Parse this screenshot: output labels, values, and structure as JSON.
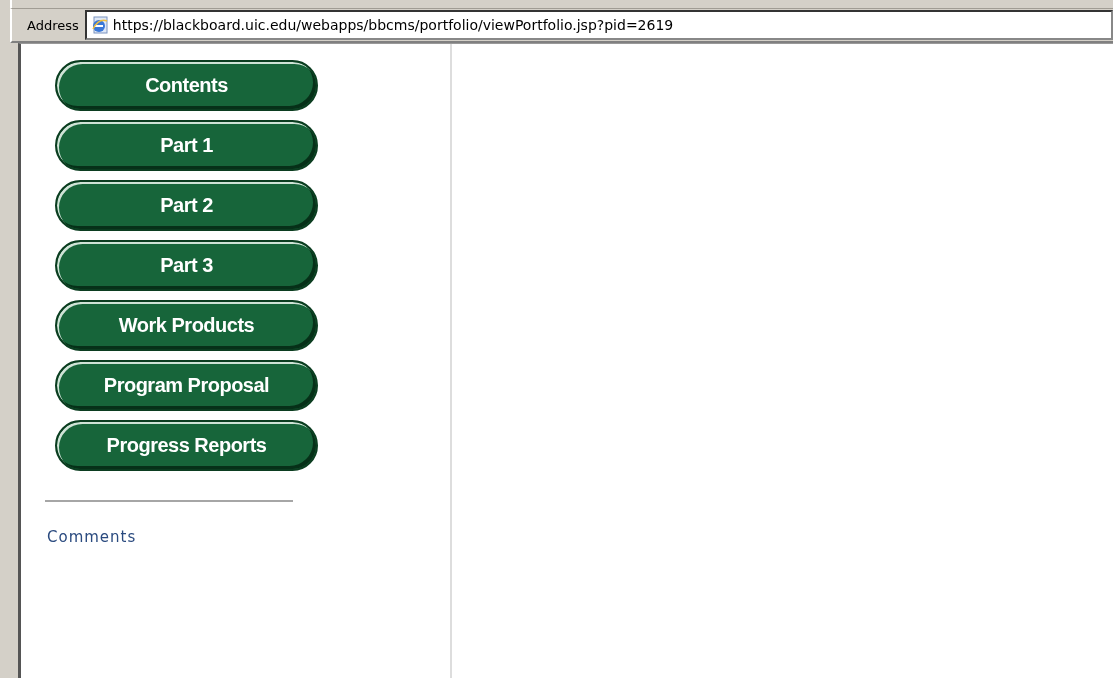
{
  "address_bar": {
    "label": "Address",
    "url": "https://blackboard.uic.edu/webapps/bbcms/portfolio/viewPortfolio.jsp?pid=2619"
  },
  "nav_buttons": [
    "Contents",
    "Part 1",
    "Part 2",
    "Part 3",
    "Work Products",
    "Program Proposal",
    "Progress Reports"
  ],
  "comments_link": "Comments"
}
